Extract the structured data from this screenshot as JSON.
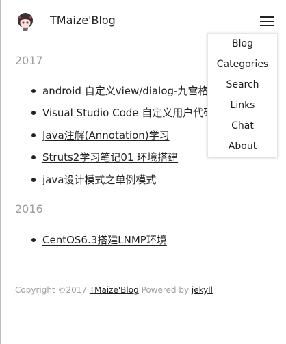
{
  "header": {
    "site_title": "TMaize'Blog",
    "avatar_icon": "anime-girl-avatar-icon",
    "menu_icon": "hamburger-menu-icon"
  },
  "menu": {
    "items": [
      {
        "label": "Blog"
      },
      {
        "label": "Categories"
      },
      {
        "label": "Search"
      },
      {
        "label": "Links"
      },
      {
        "label": "Chat"
      },
      {
        "label": "About"
      }
    ]
  },
  "archive": [
    {
      "year": "2017",
      "posts": [
        {
          "title": "android 自定义view/dialog-九宫格"
        },
        {
          "title": "Visual Studio Code 自定义用户代码片段"
        },
        {
          "title": "Java注解(Annotation)学习"
        },
        {
          "title": "Struts2学习笔记01 环境搭建"
        },
        {
          "title": "java设计模式之单例模式"
        }
      ]
    },
    {
      "year": "2016",
      "posts": [
        {
          "title": "CentOS6.3搭建LNMP环境"
        }
      ]
    }
  ],
  "footer": {
    "copyright": "Copyright ©2017 ",
    "site_link": "TMaize'Blog",
    "powered_by": " Powered by ",
    "engine_link": "jekyll"
  },
  "colors": {
    "text": "#222222",
    "muted": "#9e9e9e",
    "background": "#ffffff"
  }
}
